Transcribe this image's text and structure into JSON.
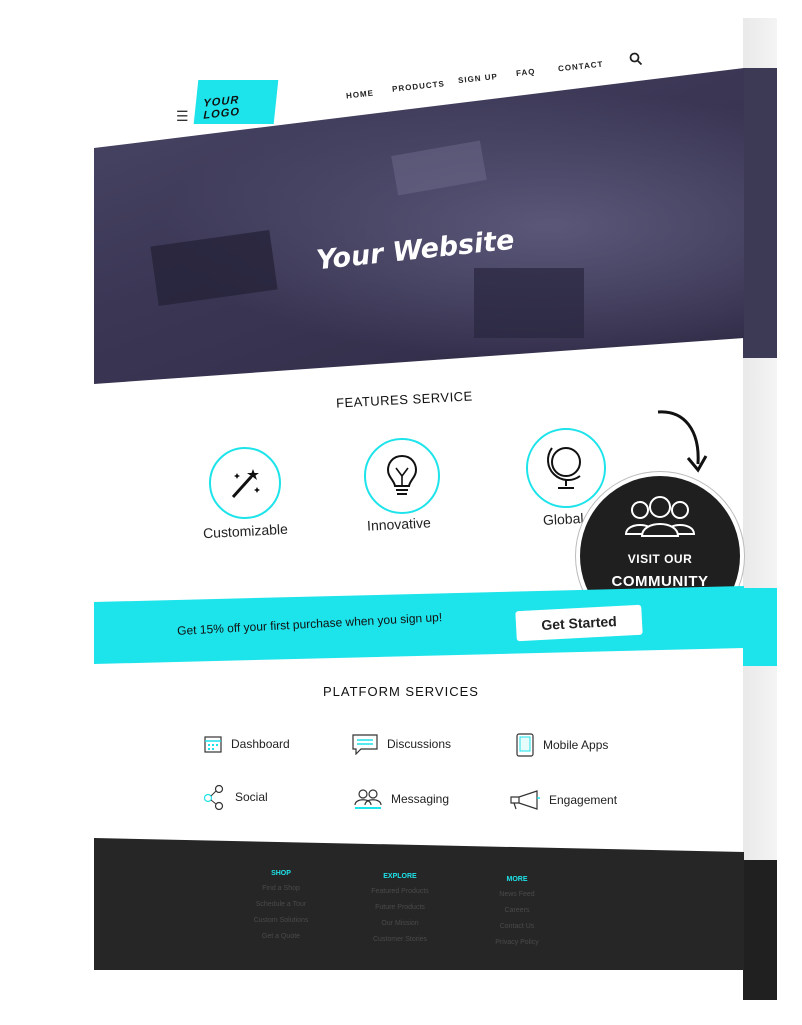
{
  "header": {
    "logo": "YOUR LOGO",
    "nav": [
      "HOME",
      "PRODUCTS",
      "SIGN UP",
      "FAQ",
      "CONTACT"
    ]
  },
  "hero": {
    "title": "Your Website"
  },
  "features": {
    "title": "FEATURES SERVICE",
    "items": [
      {
        "label": "Customizable",
        "icon": "magic-wand-icon"
      },
      {
        "label": "Innovative",
        "icon": "lightbulb-icon"
      },
      {
        "label": "Global",
        "icon": "globe-icon"
      }
    ]
  },
  "community": {
    "line1": "VISIT OUR",
    "line2": "COMMUNITY"
  },
  "promo": {
    "text": "Get 15% off your first purchase when you sign up!",
    "button": "Get Started"
  },
  "platform": {
    "title": "PLATFORM SERVICES",
    "items": [
      {
        "label": "Dashboard",
        "icon": "calendar-icon"
      },
      {
        "label": "Discussions",
        "icon": "chat-icon"
      },
      {
        "label": "Mobile Apps",
        "icon": "tablet-icon"
      },
      {
        "label": "Social",
        "icon": "share-icon"
      },
      {
        "label": "Messaging",
        "icon": "users-icon"
      },
      {
        "label": "Engagement",
        "icon": "megaphone-icon"
      }
    ]
  },
  "footer": {
    "columns": [
      {
        "heading": "SHOP",
        "links": [
          "Find a Shop",
          "Schedule a Tour",
          "Custom Solutions",
          "Get a Quote"
        ]
      },
      {
        "heading": "EXPLORE",
        "links": [
          "Featured Products",
          "Future Products",
          "Our Mission",
          "Customer Stories"
        ]
      },
      {
        "heading": "MORE",
        "links": [
          "News Feed",
          "Careers",
          "Contact Us",
          "Privacy Policy"
        ]
      }
    ]
  },
  "colors": {
    "accent": "#1de3ea",
    "hero": "#3d3a55",
    "footer": "#262626",
    "badge": "#1f1f1f"
  }
}
